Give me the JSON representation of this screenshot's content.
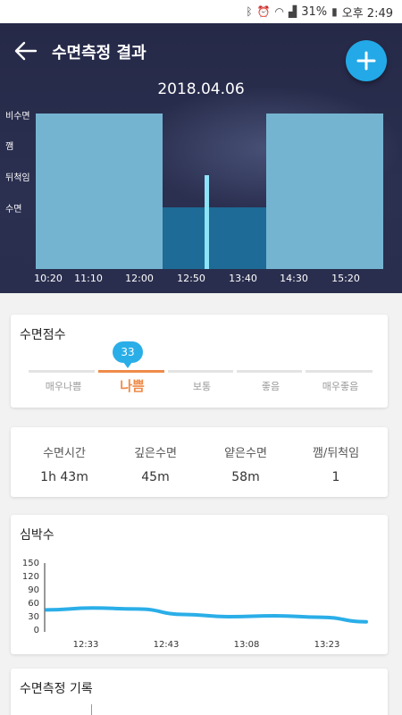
{
  "status_bar": {
    "battery": "31%",
    "time": "오후 2:49"
  },
  "header": {
    "title": "수면측정 결과",
    "date": "2018.04.06"
  },
  "hypnogram": {
    "y_levels": [
      "비수면",
      "깸",
      "뒤척임",
      "수면"
    ],
    "x_ticks": [
      "10:20",
      "11:10",
      "12:00",
      "12:50",
      "13:40",
      "14:30",
      "15:20"
    ],
    "segments": [
      {
        "state": "비수면",
        "start": "10:20",
        "end": "12:50"
      },
      {
        "state": "수면",
        "start": "12:50",
        "end": "14:30"
      },
      {
        "state": "비수면",
        "start": "14:30",
        "end": "15:40"
      }
    ],
    "markers": [
      {
        "state": "뒤척임",
        "time": "13:35"
      }
    ],
    "colors": {
      "awake_bar": "#75b4d1",
      "sleep_bar": "#1d6b96",
      "marker": "#8de3f7"
    }
  },
  "score": {
    "title": "수면점수",
    "value": "33",
    "levels": [
      "매우나쁨",
      "나쁨",
      "보통",
      "좋음",
      "매우좋음"
    ],
    "active_index": 1,
    "accent": "#ef8b49"
  },
  "stats": [
    {
      "label": "수면시간",
      "value": "1h 43m"
    },
    {
      "label": "깊은수면",
      "value": "45m"
    },
    {
      "label": "얕은수면",
      "value": "58m"
    },
    {
      "label": "깸/뒤척임",
      "value": "1"
    }
  ],
  "heart_rate": {
    "title": "심박수",
    "y_ticks": [
      "150",
      "120",
      "90",
      "60",
      "30",
      "0"
    ],
    "x_ticks": [
      "12:33",
      "12:43",
      "13:08",
      "13:23"
    ],
    "line_color": "#2aaee8"
  },
  "chart_data": {
    "type": "line",
    "title": "심박수",
    "x": [
      "12:23",
      "12:33",
      "12:43",
      "12:53",
      "13:08",
      "13:18",
      "13:23",
      "13:33"
    ],
    "series": [
      {
        "values": [
          48,
          52,
          50,
          38,
          33,
          35,
          32,
          22
        ]
      }
    ],
    "ylim": [
      0,
      150
    ],
    "yticks": [
      0,
      30,
      60,
      90,
      120,
      150
    ],
    "grid": false
  },
  "history": {
    "title": "수면측정 기록"
  }
}
